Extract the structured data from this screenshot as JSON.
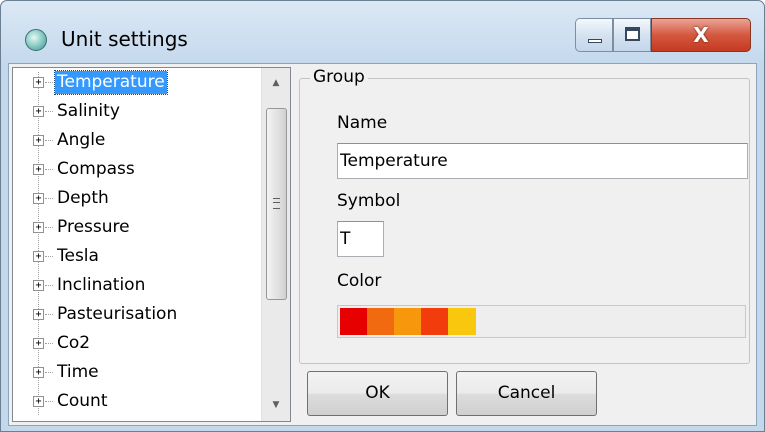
{
  "window": {
    "title": "Unit settings",
    "icon": "globe-icon",
    "caption_buttons": {
      "minimize_icon": "minimize-icon",
      "maximize_icon": "maximize-icon",
      "close_glyph": "X"
    }
  },
  "tree": {
    "expander_glyph": "+",
    "items": [
      {
        "label": "Temperature",
        "selected": true
      },
      {
        "label": "Salinity"
      },
      {
        "label": "Angle"
      },
      {
        "label": "Compass"
      },
      {
        "label": "Depth"
      },
      {
        "label": "Pressure"
      },
      {
        "label": "Tesla"
      },
      {
        "label": "Inclination"
      },
      {
        "label": "Pasteurisation"
      },
      {
        "label": "Co2"
      },
      {
        "label": "Time"
      },
      {
        "label": "Count"
      }
    ],
    "scrollbar": {
      "up_arrow": "▲",
      "down_arrow": "▼"
    }
  },
  "group": {
    "title": "Group",
    "name_label": "Name",
    "name_value": "Temperature",
    "symbol_label": "Symbol",
    "symbol_value": "T",
    "color_label": "Color",
    "color_swatches": [
      "#e60000",
      "#f26a0f",
      "#f6970c",
      "#f23c0b",
      "#f9c80e"
    ]
  },
  "buttons": {
    "ok_label": "OK",
    "cancel_label": "Cancel"
  },
  "colors": {
    "selection": "#3399ff",
    "dialog_background": "#f0f0f0",
    "frame": "#c4d8ec"
  }
}
